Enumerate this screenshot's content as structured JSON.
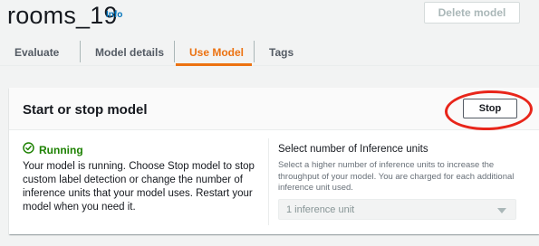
{
  "header": {
    "title": "rooms_19",
    "info_label": "Info",
    "delete_button": "Delete model"
  },
  "tabs": [
    {
      "label": "Evaluate",
      "active": false
    },
    {
      "label": "Model details",
      "active": false
    },
    {
      "label": "Use Model",
      "active": true
    },
    {
      "label": "Tags",
      "active": false
    }
  ],
  "panel": {
    "title": "Start or stop model",
    "stop_button": "Stop",
    "status": {
      "icon": "check-circle-icon",
      "label": "Running",
      "description": "Your model is running. Choose Stop model to stop custom label detection or change the number of inference units that your model uses. Restart your model when you need it."
    },
    "inference": {
      "label": "Select number of Inference units",
      "description": "Select a higher number of inference units to increase the throughput of your model. You are charged for each additional inference unit used.",
      "selected_value": "1 inference unit"
    }
  },
  "colors": {
    "accent": "#ec7211",
    "link": "#0073bb",
    "success": "#1d8102",
    "annotation": "#e8251a"
  }
}
